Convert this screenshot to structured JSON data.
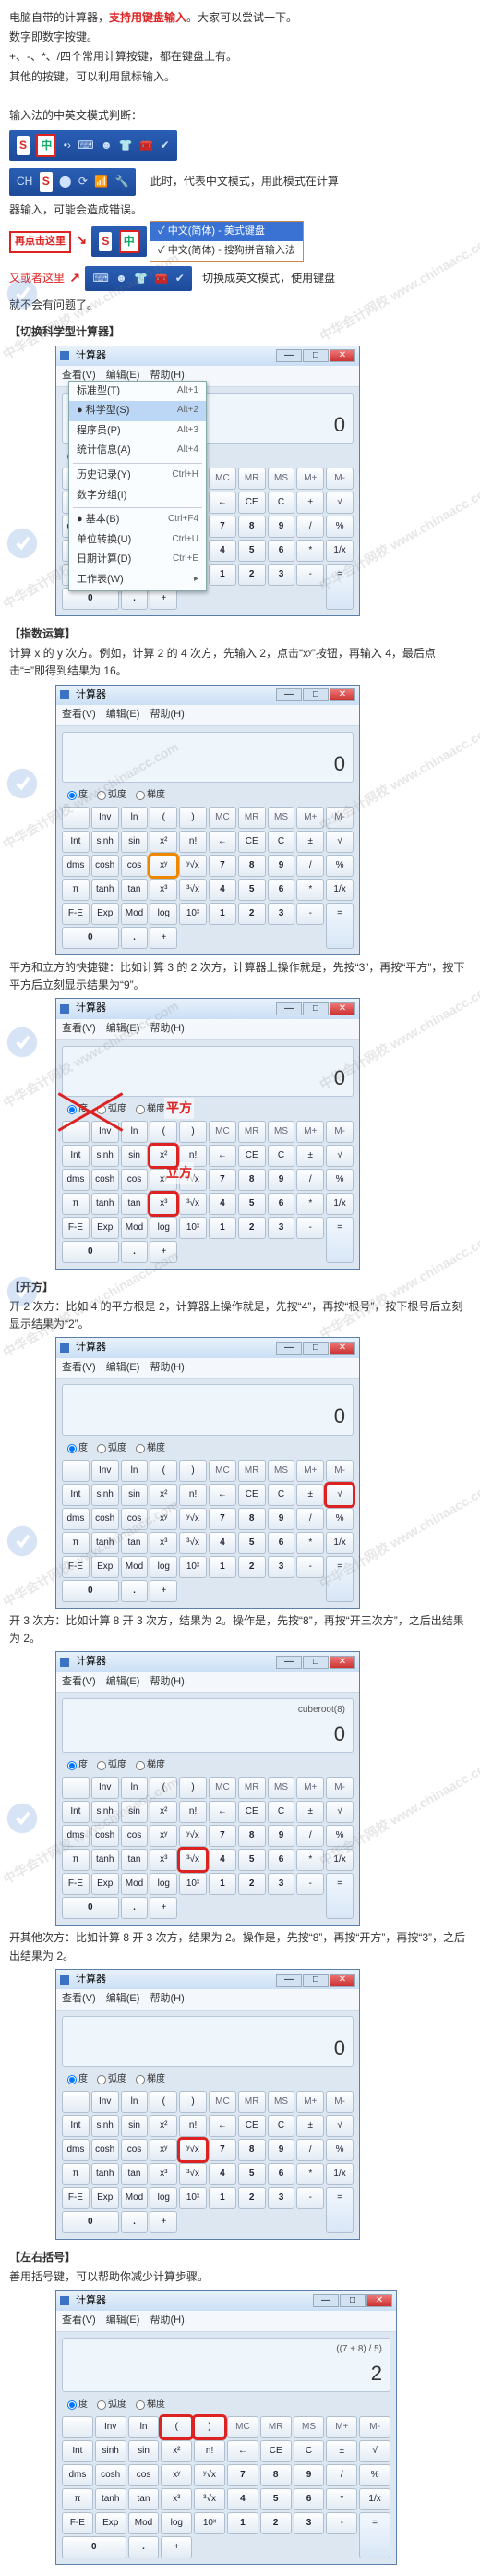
{
  "intro": {
    "p1a": "电脑自带的计算器，",
    "p1b": "支持用键盘输入",
    "p1c": "。大家可以尝试一下。",
    "p2": "数字即数字按键。",
    "p3": "+、-、*、/四个常用计算按键，都在键盘上有。",
    "p4": "其他的按键，可以利用鼠标输入。",
    "p5": "输入法的中英文模式判断：",
    "p6a": "此时，代表中文模式，用此模式在计算",
    "p6b": "器输入，可能会造成错误。",
    "p7": "再点击这里",
    "p8": "又或者这里",
    "p9a": "切换成英文模式，使用键盘",
    "p9b": "就不会有问题了。"
  },
  "ime": {
    "s": "S",
    "cn": "中",
    "ch_label": "CH",
    "opt1": "中文(简体) - 美式键盘",
    "opt2": "中文(简体) - 搜狗拼音输入法"
  },
  "sections": {
    "switch": "【切换科学型计算器】",
    "exp": "【指数运算】",
    "exp_desc": "计算 x 的 y 次方。例如，计算 2 的 4 次方，先输入 2，点击“xʸ”按钮，再输入 4，最后点击“=”即得到结果为 16。",
    "shortcut_desc": "平方和立方的快捷键：比如计算 3 的 2 次方，计算器上操作就是，先按“3”，再按“平方”，按下平方后立刻显示结果为“9”。",
    "root": "【开方】",
    "root_desc": "开 2 次方：比如 4 的平方根是 2，计算器上操作就是，先按“4”，再按“根号”，按下根号后立刻显示结果为“2”。",
    "root3_desc": "开 3 次方：比如计算 8 开 3 次方，结果为 2。操作是，先按“8”，再按“开三次方”，之后出结果为 2。",
    "rootn_desc": "开其他次方：比如计算 8 开 3 次方，结果为 2。操作是，先按“8”，再按“开方”，再按“3”，之后出结果为 2。",
    "paren": "【左右括号】",
    "paren_desc": "善用括号键，可以帮助你减少计算步骤。"
  },
  "calc": {
    "title": "计算器",
    "menu": {
      "view": "查看(V)",
      "edit": "编辑(E)",
      "help": "帮助(H)"
    },
    "winbtns": {
      "min": "—",
      "max": "□",
      "close": "✕"
    },
    "radios": {
      "deg": "度",
      "rad": "弧度",
      "grad": "梯度"
    },
    "dd": {
      "std": "标准型(T)",
      "std_sc": "Alt+1",
      "sci": "科学型(S)",
      "sci_sc": "Alt+2",
      "prog": "程序员(P)",
      "prog_sc": "Alt+3",
      "stat": "统计信息(A)",
      "stat_sc": "Alt+4",
      "hist": "历史记录(Y)",
      "hist_sc": "Ctrl+H",
      "digit": "数字分组(I)",
      "basic": "基本(B)",
      "basic_sc": "Ctrl+F4",
      "unit": "单位转换(U)",
      "unit_sc": "Ctrl+U",
      "date": "日期计算(D)",
      "date_sc": "Ctrl+E",
      "sheet": "工作表(W)"
    },
    "disp_zero": "0",
    "disp_cuberoot": "cuberoot(8)",
    "disp_paren_expr": "((7 + 8) / 5)",
    "disp_two": "2"
  },
  "keys": {
    "blank": "",
    "Inv": "Inv",
    "ln": "ln",
    "lp": "(",
    "rp": ")",
    "MC": "MC",
    "MR": "MR",
    "MS": "MS",
    "Mp": "M+",
    "Mm": "M-",
    "Int": "Int",
    "sinh": "sinh",
    "sin": "sin",
    "x2": "x²",
    "nfac": "n!",
    "back": "←",
    "CE": "CE",
    "C": "C",
    "pm": "±",
    "sqrt": "√",
    "dms": "dms",
    "cosh": "cosh",
    "cos": "cos",
    "xy": "xʸ",
    "yrx": "ʸ√x",
    "7": "7",
    "8": "8",
    "9": "9",
    "div": "/",
    "pct": "%",
    "pi": "π",
    "tanh": "tanh",
    "tan": "tan",
    "x3": "x³",
    "cbrt": "³√x",
    "4": "4",
    "5": "5",
    "6": "6",
    "mul": "*",
    "inv": "1/x",
    "FE": "F-E",
    "Exp": "Exp",
    "Mod": "Mod",
    "log": "log",
    "tenx": "10ˣ",
    "1": "1",
    "2": "2",
    "3": "3",
    "sub": "-",
    "eq": "=",
    "0": "0",
    "dot": ".",
    "add": "+"
  },
  "anno": {
    "square": "平方",
    "cube": "立方"
  },
  "watermark": "中华会计网校 www.chinaacc.com"
}
